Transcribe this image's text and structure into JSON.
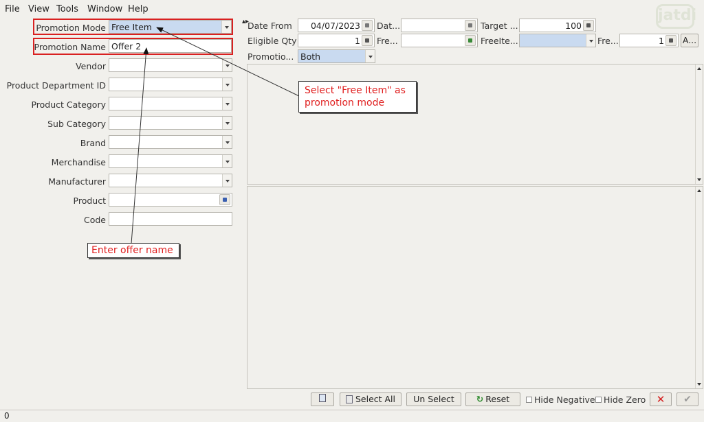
{
  "menu": [
    {
      "id": "file",
      "label": "File"
    },
    {
      "id": "view",
      "label": "View"
    },
    {
      "id": "tools",
      "label": "Tools"
    },
    {
      "id": "window",
      "label": "Window"
    },
    {
      "id": "help",
      "label": "Help"
    }
  ],
  "logo_text": "jatdi",
  "filters": {
    "promotion_mode": {
      "label": "Promotion Mode",
      "value": "Free Item"
    },
    "promotion_name": {
      "label": "Promotion Name",
      "value": "Offer 2"
    },
    "vendor": {
      "label": "Vendor",
      "value": ""
    },
    "product_department_id": {
      "label": "Product Department ID",
      "value": ""
    },
    "product_category": {
      "label": "Product Category",
      "value": ""
    },
    "sub_category": {
      "label": "Sub Category",
      "value": ""
    },
    "brand": {
      "label": "Brand",
      "value": ""
    },
    "merchandise": {
      "label": "Merchandise",
      "value": ""
    },
    "manufacturer": {
      "label": "Manufacturer",
      "value": ""
    },
    "product": {
      "label": "Product",
      "value": ""
    },
    "code": {
      "label": "Code",
      "value": ""
    }
  },
  "settings": {
    "date_from": {
      "label": "Date From",
      "value": "04/07/2023"
    },
    "date_to": {
      "label": "Dat...",
      "value": ""
    },
    "target": {
      "label": "Target ...",
      "value": "100"
    },
    "eligible_qty": {
      "label": "Eligible Qty",
      "value": "1"
    },
    "free": {
      "label": "Fre...",
      "value": ""
    },
    "free_item": {
      "label": "FreeIte...",
      "value": ""
    },
    "free_qty": {
      "label": "Fre...",
      "value": "1"
    },
    "a_button": "A...",
    "promotion_type": {
      "label": "Promotio...",
      "value": "Both"
    }
  },
  "annotations": {
    "select_mode": "Select \"Free Item\" as promotion mode",
    "enter_name": "Enter offer name"
  },
  "toolbar": {
    "select_all": "Select All",
    "un_select": "Un Select",
    "reset": "Reset",
    "hide_negative": "Hide Negative",
    "hide_zero": "Hide Zero"
  },
  "status": {
    "count": "0"
  },
  "colors": {
    "accent_blue": "#c9daf0",
    "highlight_pink": "#f7c8c8",
    "annotation_red": "#e02020"
  }
}
